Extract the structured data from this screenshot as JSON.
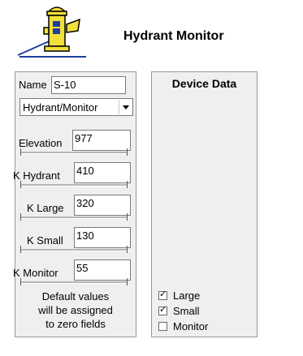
{
  "header": {
    "title": "Hydrant Monitor",
    "logo_icon": "hydrant-icon"
  },
  "form": {
    "name_label": "Name",
    "name_value": "S-10",
    "type_select_value": "Hydrant/Monitor",
    "elevation_label": "Elevation",
    "elevation_value": "977",
    "k_hydrant_label": "K Hydrant",
    "k_hydrant_value": "410",
    "k_large_label": "K Large",
    "k_large_value": "320",
    "k_small_label": "K Small",
    "k_small_value": "130",
    "k_monitor_label": "K Monitor",
    "k_monitor_value": "55",
    "note_line1": "Default values",
    "note_line2": "will be assigned",
    "note_line3": "to zero fields"
  },
  "device": {
    "title": "Device Data",
    "options": [
      {
        "label": "Large",
        "checked": true
      },
      {
        "label": "Small",
        "checked": true
      },
      {
        "label": "Monitor",
        "checked": false
      }
    ]
  },
  "colors": {
    "panel_bg": "#efefef",
    "border": "#9a9a9a",
    "logo_yellow": "#f2e03a",
    "logo_line": "#1e3fa0"
  }
}
